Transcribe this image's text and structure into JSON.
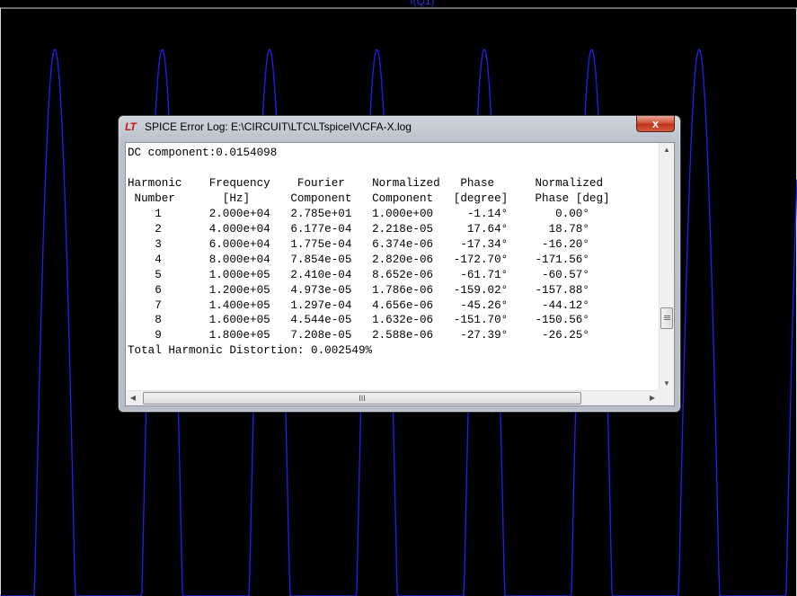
{
  "background_plot": {
    "trace_label": "I(Q1)",
    "trace_color": "#1e1ee6",
    "background_color": "#000000"
  },
  "window": {
    "app_icon": "LT",
    "title": "SPICE Error Log: E:\\CIRCUIT\\LTC\\LTspiceIV\\CFA-X.log",
    "close_label": "x"
  },
  "log": {
    "lines": [
      "DC component:0.0154098",
      "",
      "Harmonic    Frequency    Fourier    Normalized   Phase      Normalized",
      " Number       [Hz]      Component   Component   [degree]    Phase [deg]",
      "    1       2.000e+04   2.785e+01   1.000e+00     -1.14°       0.00°",
      "    2       4.000e+04   6.177e-04   2.218e-05     17.64°      18.78°",
      "    3       6.000e+04   1.775e-04   6.374e-06    -17.34°     -16.20°",
      "    4       8.000e+04   7.854e-05   2.820e-06   -172.70°    -171.56°",
      "    5       1.000e+05   2.410e-04   8.652e-06    -61.71°     -60.57°",
      "    6       1.200e+05   4.973e-05   1.786e-06   -159.02°    -157.88°",
      "    7       1.400e+05   1.297e-04   4.656e-06    -45.26°     -44.12°",
      "    8       1.600e+05   4.544e-05   1.632e-06   -151.70°    -150.56°",
      "    9       1.800e+05   7.208e-05   2.588e-06    -27.39°     -26.25°",
      "Total Harmonic Distortion: 0.002549%"
    ]
  },
  "scrollbars": {
    "up_arrow": "▲",
    "down_arrow": "▼",
    "left_arrow": "◀",
    "right_arrow": "▶",
    "h_thumb_grip": "III"
  }
}
